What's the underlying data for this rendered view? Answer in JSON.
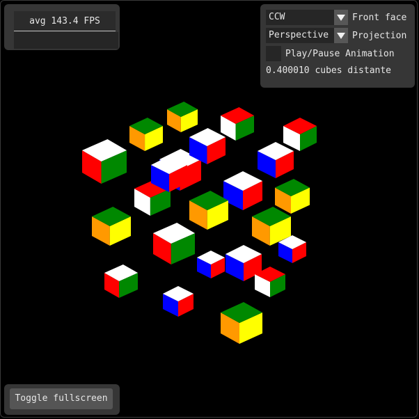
{
  "stats": {
    "fps_text": "avg 143.4 FPS"
  },
  "controls": {
    "front_face": {
      "value": "CCW",
      "label": "Front face"
    },
    "projection": {
      "value": "Perspective",
      "label": "Projection"
    },
    "animation": {
      "label": "Play/Pause Animation",
      "checked": false
    },
    "distance_text": "0.400010 cubes distante"
  },
  "actions": {
    "fullscreen_label": "Toggle fullscreen"
  },
  "scene": {
    "colors": {
      "white": "#ffffff",
      "red": "#ff0000",
      "green": "#008800",
      "blue": "#0000ff",
      "yellow": "#ffff00",
      "orange": "#ff9900"
    },
    "cubes": [
      {
        "top": "white",
        "left": "red",
        "right": "green"
      },
      {
        "top": "white",
        "left": "blue",
        "right": "red"
      },
      {
        "top": "green",
        "left": "orange",
        "right": "yellow"
      },
      {
        "top": "white",
        "left": "blue",
        "right": "red"
      },
      {
        "top": "red",
        "left": "white",
        "right": "green"
      },
      {
        "top": "green",
        "left": "orange",
        "right": "yellow"
      },
      {
        "top": "red",
        "left": "white",
        "right": "green"
      },
      {
        "top": "white",
        "left": "blue",
        "right": "red"
      },
      {
        "top": "white",
        "left": "red",
        "right": "green"
      },
      {
        "top": "green",
        "left": "orange",
        "right": "yellow"
      },
      {
        "top": "white",
        "left": "blue",
        "right": "red"
      },
      {
        "top": "red",
        "left": "white",
        "right": "green"
      },
      {
        "top": "green",
        "left": "orange",
        "right": "yellow"
      },
      {
        "top": "white",
        "left": "red",
        "right": "green"
      },
      {
        "top": "white",
        "left": "blue",
        "right": "red"
      },
      {
        "top": "green",
        "left": "orange",
        "right": "yellow"
      },
      {
        "top": "white",
        "left": "blue",
        "right": "red"
      },
      {
        "top": "green",
        "left": "orange",
        "right": "yellow"
      },
      {
        "top": "white",
        "left": "blue",
        "right": "red"
      },
      {
        "top": "white",
        "left": "blue",
        "right": "red"
      },
      {
        "top": "red",
        "left": "white",
        "right": "green"
      },
      {
        "top": "white",
        "left": "blue",
        "right": "red"
      },
      {
        "top": "green",
        "left": "orange",
        "right": "yellow"
      }
    ]
  }
}
